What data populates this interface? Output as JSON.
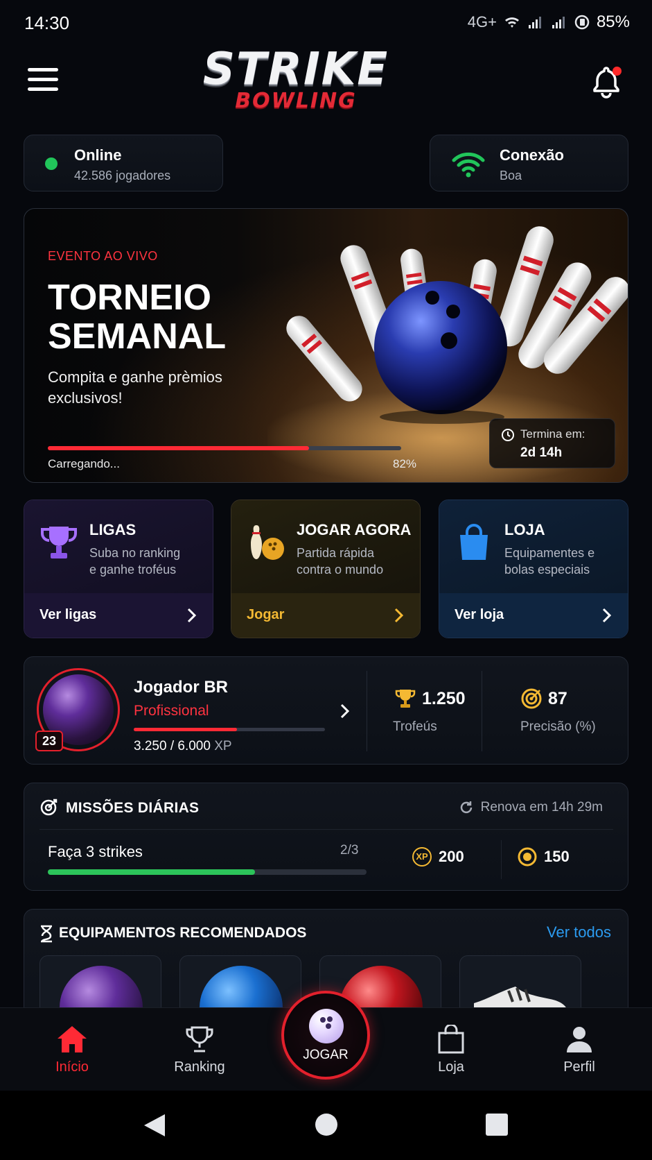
{
  "status_bar": {
    "time": "14:30",
    "network": "4G+",
    "battery": "85%"
  },
  "header": {
    "logo_main": "STRIKE",
    "logo_sub": "BOWLING",
    "has_notification": true
  },
  "online": {
    "title": "Online",
    "subtitle": "42.586 jogadores",
    "color": "#21c55a"
  },
  "connection": {
    "title": "Conexão",
    "subtitle": "Boa",
    "color": "#21c55a"
  },
  "banner": {
    "tag": "EVENTO AO VIVO",
    "title_line1": "TORNEIO",
    "title_line2": "SEMANAL",
    "description": "Compita e ganhe prèmios exclusivos!",
    "progress_label": "Carregando...",
    "progress_value": "82%",
    "progress_fraction": 0.74,
    "timer_label": "Termina em:",
    "timer_value": "2d 14h"
  },
  "features": [
    {
      "title": "LIGAS",
      "desc1": "Suba no ranking",
      "desc2": "e ganhe troféus",
      "link": "Ver ligas",
      "icon": "trophy-icon"
    },
    {
      "title": "JOGAR AGORA",
      "desc1": "Partida rápida",
      "desc2": "contra o mundo",
      "link": "Jogar",
      "icon": "bowling-icon"
    },
    {
      "title": "LOJA",
      "desc1": "Equipamentes e",
      "desc2": "bolas especiais",
      "link": "Ver loja",
      "icon": "shopping-bag-icon"
    }
  ],
  "profile": {
    "name": "Jogador BR",
    "rank": "Profissional",
    "level": "23",
    "xp_current": "3.250",
    "xp_total": "6.000",
    "xp_label": "XP",
    "xp_fraction": 0.54,
    "trophies_value": "1.250",
    "trophies_label": "Trofeús",
    "precision_value": "87",
    "precision_label": "Precisão (%)"
  },
  "missions": {
    "title": "MISSÕES DIÁRIAS",
    "renew": "Renova em 14h 29m",
    "task": "Faça 3 strikes",
    "count": "2/3",
    "fraction": 0.65,
    "xp_icon": "XP",
    "xp_reward": "200",
    "coin_reward": "150"
  },
  "equipment": {
    "title": "EQUIPAMENTOS RECOMENDADOS",
    "see_all": "Ver todos",
    "items": [
      {
        "icon": "purple-ball-icon",
        "color": "#6a2fa5"
      },
      {
        "icon": "blue-ball-icon",
        "color": "#1a6fd0"
      },
      {
        "icon": "red-ball-icon",
        "color": "#c2161f"
      },
      {
        "icon": "shoe-icon",
        "color": "#e9e9e9"
      }
    ]
  },
  "nav": {
    "home": "Início",
    "ranking": "Ranking",
    "play": "JOGAR",
    "shop": "Loja",
    "profile": "Perfil"
  }
}
